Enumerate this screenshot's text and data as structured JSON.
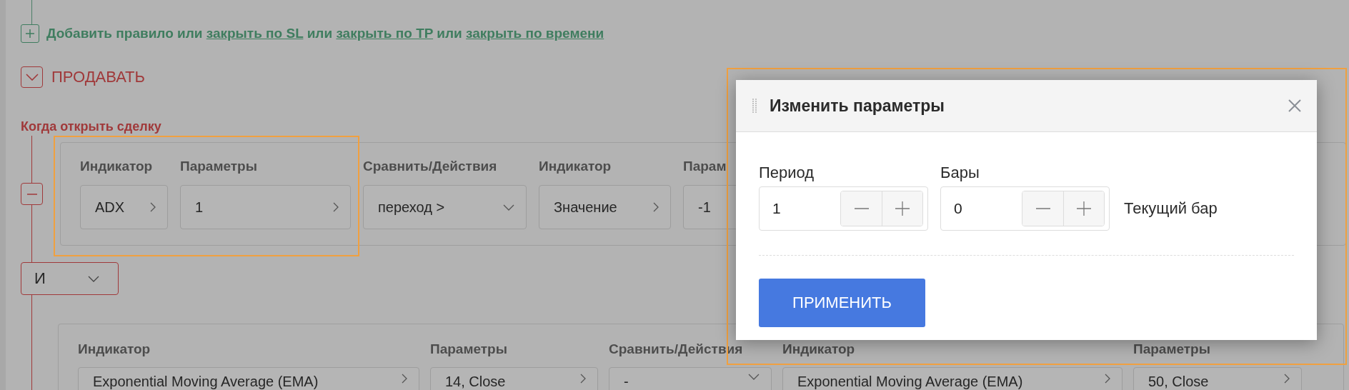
{
  "add_rule_line": {
    "parts": [
      {
        "kind": "text",
        "text": "Добавить правило или "
      },
      {
        "kind": "link",
        "text": "закрыть по SL"
      },
      {
        "kind": "text",
        "text": " или "
      },
      {
        "kind": "link",
        "text": "закрыть по TP"
      },
      {
        "kind": "text",
        "text": " или "
      },
      {
        "kind": "link",
        "text": "закрыть по времени"
      }
    ]
  },
  "sell_section": {
    "title": "ПРОДАВАТЬ",
    "expanded": true
  },
  "open_condition": {
    "title": "Когда открыть сделку"
  },
  "rule_1": {
    "columns": [
      {
        "label": "Индикатор",
        "value": "ADX",
        "kind": "picker"
      },
      {
        "label": "Параметры",
        "value": "1",
        "kind": "picker"
      },
      {
        "label": "Сравнить/Действия",
        "value": "переход >",
        "kind": "dropdown"
      },
      {
        "label": "Индикатор",
        "value": "Значение",
        "kind": "picker"
      },
      {
        "label": "Парам",
        "value": "-1",
        "kind": "picker"
      }
    ]
  },
  "logic_operator": {
    "value": "И"
  },
  "rule_2": {
    "columns": [
      {
        "label": "Индикатор",
        "value": "Exponential Moving Average (EMA)",
        "kind": "picker"
      },
      {
        "label": "Параметры",
        "value": "14, Close",
        "kind": "picker"
      },
      {
        "label": "Сравнить/Действия",
        "value": "-",
        "kind": "dropdown"
      },
      {
        "label": "Индикатор",
        "value": "Exponential Moving Average (EMA)",
        "kind": "picker"
      },
      {
        "label": "Параметры",
        "value": "50, Close",
        "kind": "picker"
      }
    ]
  },
  "dialog": {
    "title": "Изменить параметры",
    "fields": [
      {
        "label": "Период",
        "value": "1"
      },
      {
        "label": "Бары",
        "value": "0",
        "note": "Текущий бар"
      }
    ],
    "apply_button": "ПРИМЕНИТЬ"
  }
}
